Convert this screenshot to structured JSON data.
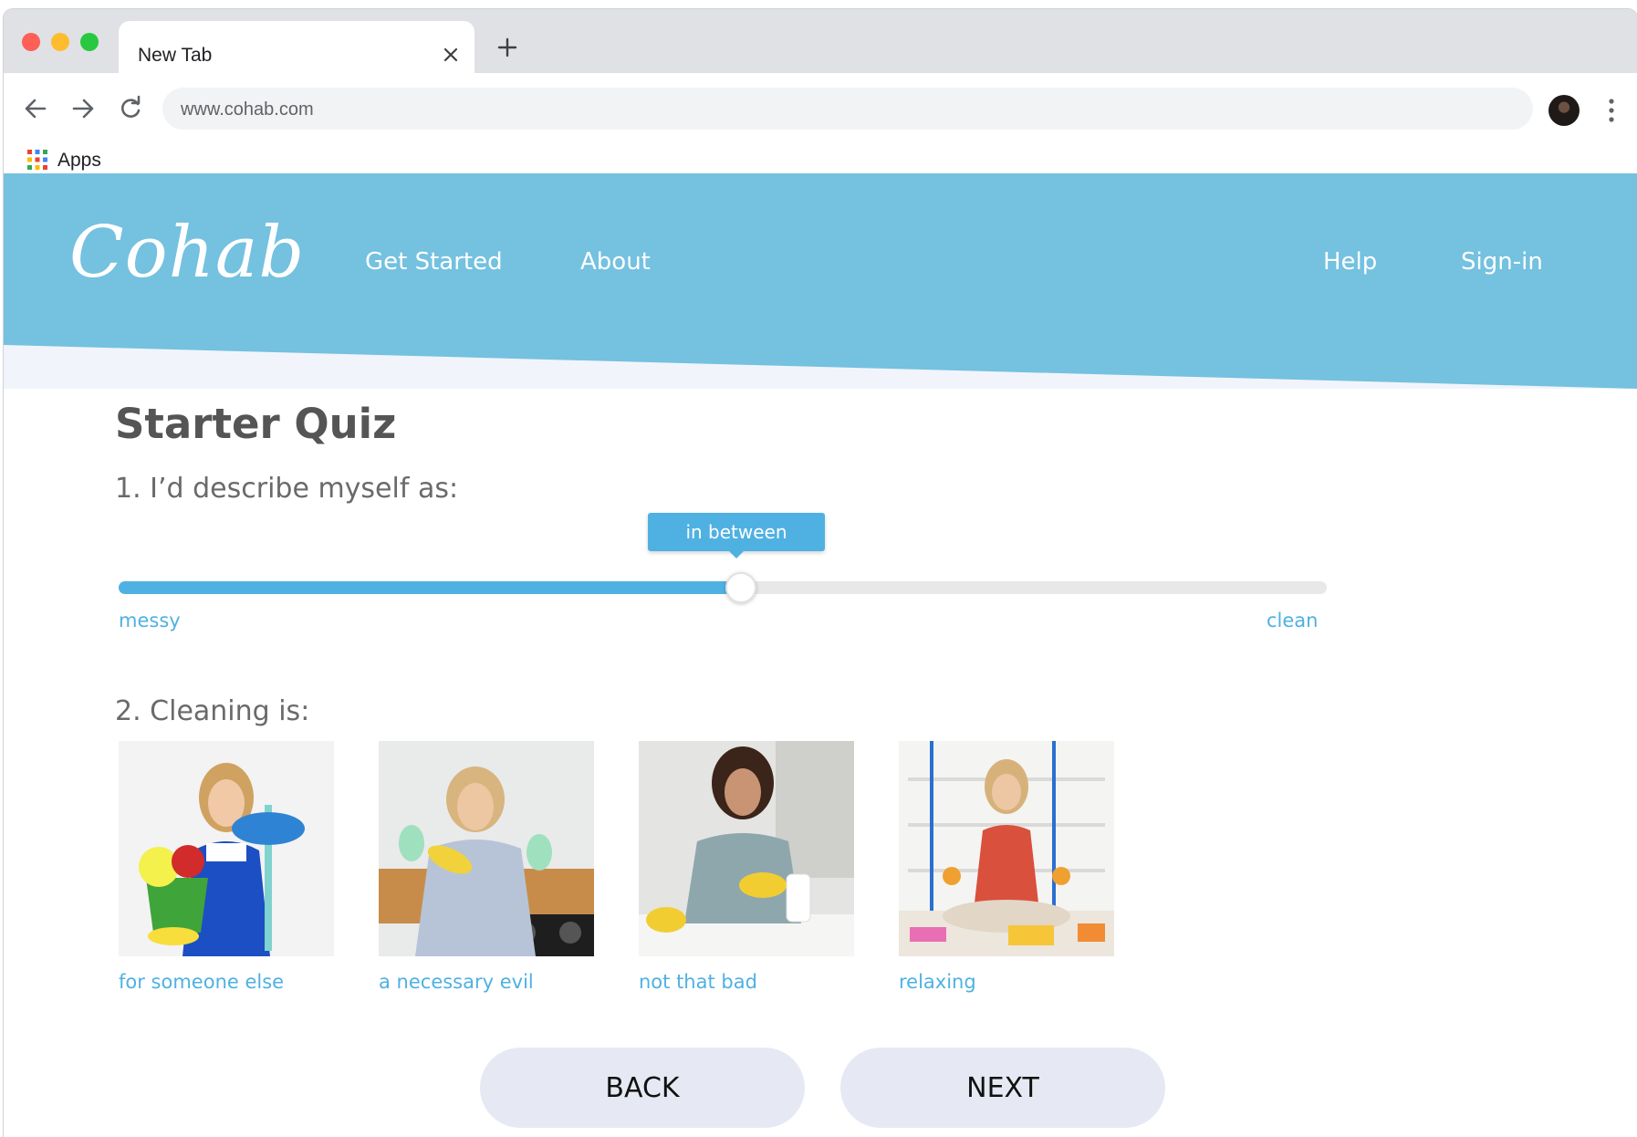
{
  "browser": {
    "tab_title": "New Tab",
    "url": "www.cohab.com",
    "bookmarks": {
      "apps_label": "Apps"
    }
  },
  "site": {
    "logo": "Cohab",
    "nav": {
      "get_started": "Get Started",
      "about": "About",
      "help": "Help",
      "sign_in": "Sign-in"
    },
    "colors": {
      "header": "#74c1e0",
      "accent": "#4fb1e2",
      "button": "#e6e9f4"
    }
  },
  "quiz": {
    "title": "Starter Quiz",
    "q1": {
      "prompt": "1. I’d describe myself as:",
      "slider_value_label": "in between",
      "slider_value_fraction": 0.515,
      "min_label": "messy",
      "max_label": "clean"
    },
    "q2": {
      "prompt": "2. Cleaning is:",
      "options": [
        {
          "label": "for someone else"
        },
        {
          "label": "a necessary evil"
        },
        {
          "label": "not that bad"
        },
        {
          "label": "relaxing"
        }
      ]
    },
    "buttons": {
      "back": "BACK",
      "next": "NEXT"
    }
  }
}
